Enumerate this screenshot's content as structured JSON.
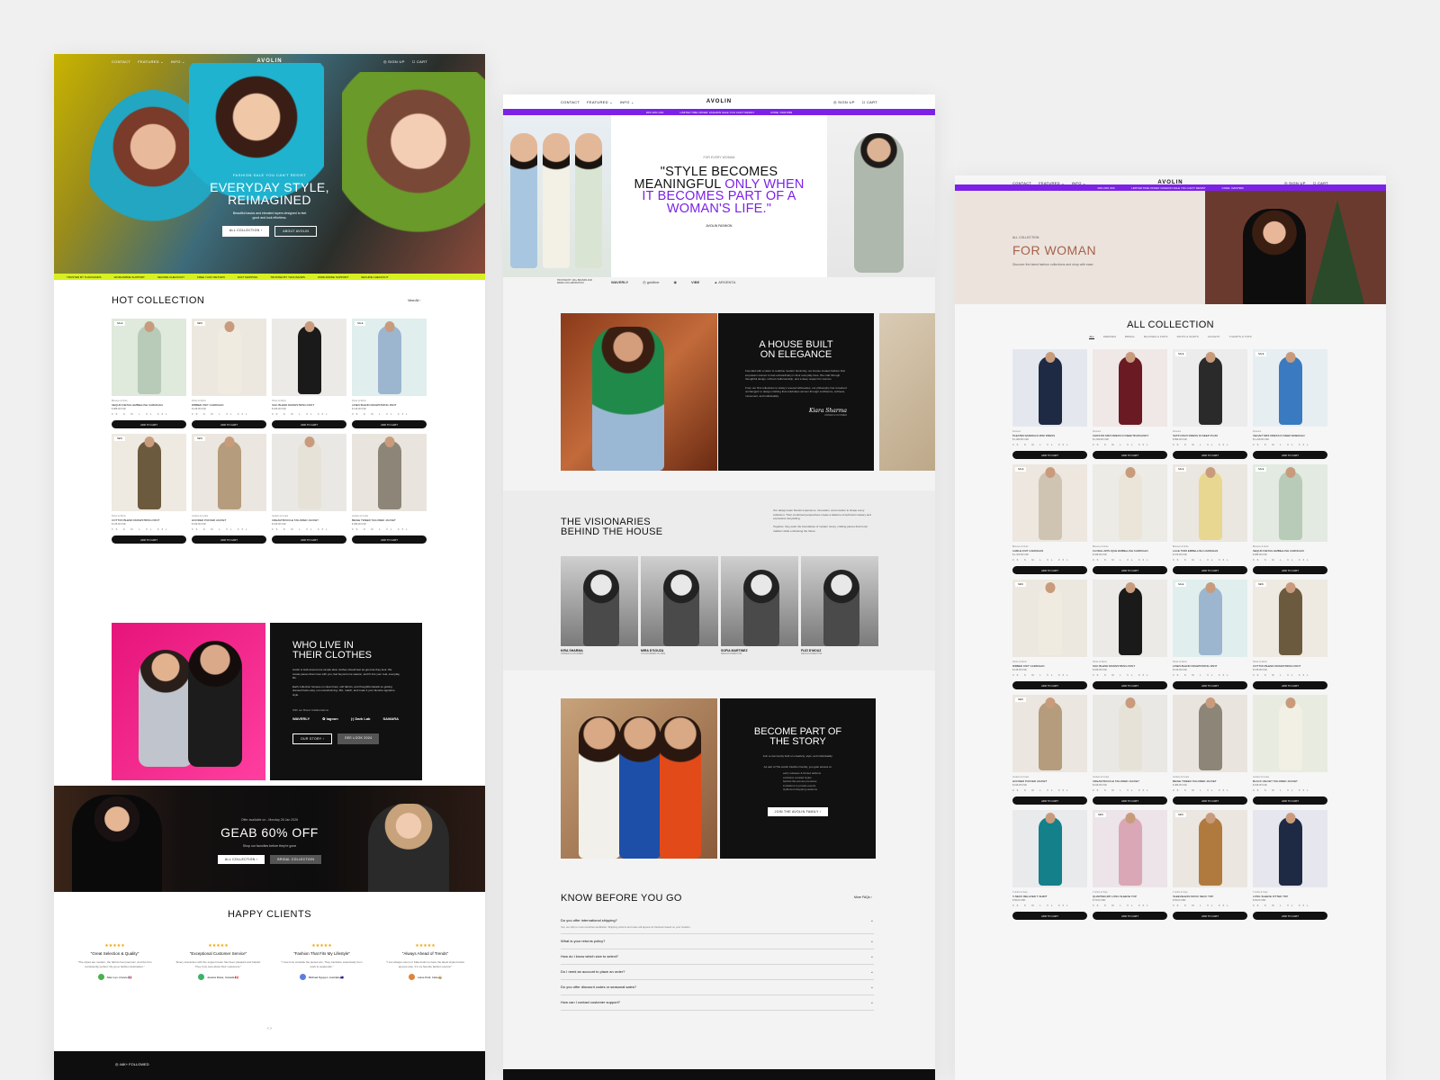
{
  "nav": {
    "left": [
      "CONTACT",
      "FEATURED ⌄",
      "INFO ⌄"
    ],
    "logo": "AVOLIN",
    "right": [
      "◎ SIGN UP",
      "☐ CART"
    ]
  },
  "promo": [
    "20% 20% OFF",
    "LIMITED TIME OFFER: FASHION SALE YOU CAN'T RESIST",
    "CODE: X2047989"
  ],
  "p1": {
    "hero": {
      "kicker": "FASHION SALE YOU CAN'T RESIST",
      "title_1": "EVERYDAY STYLE,",
      "title_2": "REIMAGINED",
      "sub": "Beautiful basics and elevated layers designed to feel good and look effortless.",
      "btn_1": "ALL COLLECTION ›",
      "btn_2": "ABOUT AVOLIN"
    },
    "ticker": [
      "TRUSTED BY THOUSANDS",
      "WORLDWIDE SUPPORT",
      "SECURE CHECKOUT",
      "FREE 7-DAY RETURN",
      "FAST SHIPPING",
      "TRUSTED BY THOUSANDS",
      "WORLDWIDE SUPPORT",
      "SECURE CHECKOUT"
    ],
    "hot_title": "HOT COLLECTION",
    "view_all": "View All ›",
    "products": [
      {
        "badge": "SALE",
        "cat": "Blouses & Knits",
        "name": "SEQUIN DETAIL EMBELLISH CARDIGAN",
        "price": "$ 988.00 USD",
        "bg": "#dfe9dc",
        "col": "#b7cbb8"
      },
      {
        "badge": "NEW",
        "cat": "Pants & Skirts",
        "name": "RIBBED KNIT CARDIGAN",
        "price": "$ 148.00 USD",
        "bg": "#ede8df",
        "col": "#f0ebe0"
      },
      {
        "badge": "",
        "cat": "Pants & Skirts",
        "name": "SILK BLEND DRAWSTRING PANT",
        "price": "$ 189.00 USD",
        "bg": "#eceae6",
        "col": "#1a1a1a"
      },
      {
        "badge": "SALE",
        "cat": "Pants & Skirts",
        "name": "LINEN BLEND DRAWSTRING PANT",
        "price": "$ 149.00 USD",
        "bg": "#e0eeed",
        "col": "#9cb6cf"
      },
      {
        "badge": "NEW",
        "cat": "Pants & Skirts",
        "name": "COTTON BLEND DRAWSTRING PANT",
        "price": "$ 135.00 USD",
        "bg": "#eee9e1",
        "col": "#6b5a3e"
      },
      {
        "badge": "NEW",
        "cat": "Jackets & Coats",
        "name": "HOODED PUFFER JACKET",
        "price": "$ 199.00 USD",
        "bg": "#ebe6df",
        "col": "#b59c7c"
      },
      {
        "badge": "",
        "cat": "Jackets & Coats",
        "name": "CREAM BOUCLE TAILORED JACKET",
        "price": "$ 199.00 USD",
        "bg": "#eae8e4",
        "col": "#e6e2d8"
      },
      {
        "badge": "",
        "cat": "Jackets & Coats",
        "name": "BEIGE TWEED TAILORED JACKET",
        "price": "$ 489.00 USD",
        "bg": "#e9e5de",
        "col": "#8c8578"
      }
    ],
    "sizes": "XS S M L XL XXL",
    "add_label": "ADD TO CART",
    "who": {
      "title_1": "WHO LIVE IN",
      "title_2": "THEIR CLOTHES",
      "p1": "Avolin is built around one simple idea: clothes should feel as good as they look. We create pieces that move with you, last beyond one season, and fit into your real, everyday life.",
      "p2": "Each collection focuses on clean lines, soft fabrics, and thoughtful details so getting dressed feels easy, not overwhelming. Mix, match, and make it your favorite signature style.",
      "with": "With our Brand Collaborations",
      "logos": [
        "WAVERLY",
        "✿ lagoon",
        "|·| Dark Lab",
        "SAMARA"
      ],
      "btn_1": "OUR STORY ›",
      "btn_2": "SEE LOOK 2024"
    },
    "sale": {
      "offer": "Offer available on - Monday 26 Jan 2026",
      "title": "GEAB 60% OFF",
      "sub": "Shop our favorites before they're gone",
      "btn_1": "ALL COLLECTION ›",
      "btn_2": "BRIDAL COLLECTION"
    },
    "happy_title": "HAPPY CLIENTS",
    "reviews": [
      {
        "title": "\"Great Selection & Quality\"",
        "body": "\"The styles are modern, the fabrics feel premium, and the fit is consistently perfect. My go-to fashion destination.\"",
        "author": "Allen Lyn, France 🇫🇷",
        "av": "#4caf50"
      },
      {
        "title": "\"Exceptional Customer Service\"",
        "body": "\"Every interaction with the support team has been pleasant and helpful. They truly care about their customers.\"",
        "author": "Jessica Davis, Canada 🇨🇦",
        "av": "#3ab26a"
      },
      {
        "title": "\"Fashion That Fits My Lifestyle\"",
        "body": "\"I love how versatile the pieces are. They transition seamlessly from work to weekends.\"",
        "author": "Michael Nguyen, Australia 🇦🇺",
        "av": "#5b7de0"
      },
      {
        "title": "\"Always Ahead of Trends\"",
        "body": "\"I can always count on Kala Avolin to have the latest styles before anyone else. It's my favorite fashion source!\"",
        "author": "Liane Petit, India 🇮🇳",
        "av": "#e0843a"
      }
    ],
    "pager": "‹   ›",
    "followed": "◎ 44K+ FOLLOWED"
  },
  "p2": {
    "kicker": "FOR EVERY WOMAN",
    "quote_1": "\"STYLE BECOMES",
    "quote_2a": "MEANINGFUL ",
    "quote_2b": "ONLY WHEN",
    "quote_3": "IT BECOMES PART OF A",
    "quote_4": "WOMAN'S LIFE.\"",
    "by": "AVOLIN FASHION",
    "trusted_sm": "TRUSTED BY 100+ BRANDS AND MEDIA COLLABORATION",
    "trusted_logos": [
      "WAVERLY",
      "◎ goldline",
      "◉",
      "VIBE",
      "▲ ARGENTA"
    ],
    "house": {
      "title_1": "A HOUSE BUILT",
      "title_2": "ON ELEGANCE",
      "p1": "Founded with a vision to redefine modern femininity, our House creates fashion that empowers women to feel extraordinary in their everyday lives. We craft through thoughtful design, refined craftsmanship, and a deep respect for woman.",
      "p2": "From our first collections to today's revered silhouettes, our philosophy has remained unchanged: to design clothing that celebrates women through confidence, softness, movement, and individuality.",
      "sig": "Kiara Sharma",
      "sig_role": "OWNER & FOUNDER"
    },
    "vis": {
      "title_1": "THE VISIONARIES",
      "title_2": "BEHIND THE HOUSE",
      "p1": "Our design team blends experience, innovation, and emotion to shape every collection. Their combined perspectives create a balance of technical mastery and expressive storytelling.",
      "p2": "Together, they push the boundaries of modern luxury, crafting pieces that honor tradition while embracing the future.",
      "team": [
        {
          "name": "KIRA SHARMA",
          "role": "OWNER & FOUNDER"
        },
        {
          "name": "MIRA D'SOUZA",
          "role": "CO-FOUNDER OF ARM"
        },
        {
          "name": "SOFIA MARTINEZ",
          "role": "DESIGN DIRECTOR"
        },
        {
          "name": "FUZI D'MOUZ",
          "role": "DESIGN DIRECTOR"
        }
      ]
    },
    "story": {
      "title_1": "BECOME PART OF",
      "title_2": "THE STORY",
      "s1": "Join a community built on creativity, style, and individuality.",
      "s2": "As part of The Avolin Fashion Family, you gain access to:",
      "list": [
        "early releases & limited editions",
        "exclusive curated styles",
        "behind-the-scenes previews",
        "invitations to private events",
        "stylist-led shopping sessions"
      ],
      "join": "JOIN THE AVOLIN FAMILY ›"
    },
    "faq_title": "KNOW BEFORE YOU GO",
    "faq_more": "More FAQs ›",
    "faq": [
      {
        "q": "Do you offer international shipping?",
        "a": "Yes, we ship to most countries worldwide. Shipping options and rates will appear at checkout based on your location."
      },
      {
        "q": "What is your returns policy?",
        "a": ""
      },
      {
        "q": "How do I know which size to select?",
        "a": ""
      },
      {
        "q": "Do I need an account to place an order?",
        "a": ""
      },
      {
        "q": "Do you offer discount codes or seasonal sales?",
        "a": ""
      },
      {
        "q": "How can I contact customer support?",
        "a": ""
      }
    ]
  },
  "p3": {
    "kicker": "ALL COLLECTION",
    "title": "FOR WOMAN",
    "sub": "Discover the latest fashion collections and shop with ease.",
    "all_title": "ALL COLLECTION",
    "tabs": [
      "ALL",
      "DRESSES",
      "BRIDAL",
      "BLOUSES & KNITS",
      "PANTS & SKIRTS",
      "JACKETS",
      "T-SHIRTS & TOPS"
    ],
    "products": [
      {
        "badge": "",
        "cat": "Dresses",
        "name": "PLEATED EMERALD MIDI DRESS",
        "price": "$ 1,089.00 USD",
        "bg": "#e4e8ee",
        "col": "#1e2a44"
      },
      {
        "badge": "",
        "cat": "Dresses",
        "name": "CHIFFON MIDI DRESS IN DEEP BURGUNDY",
        "price": "$ 1,099.00 USD",
        "bg": "#efe8e6",
        "col": "#6a1a22"
      },
      {
        "badge": "SALE",
        "cat": "Dresses",
        "name": "SATIN MAXI DRESS IN DEEP PLUM",
        "price": "$ 899.00 USD",
        "bg": "#ececec",
        "col": "#2a2a2a"
      },
      {
        "badge": "SALE",
        "cat": "Dresses",
        "name": "VELVET MIDI DRESS IN DEEP EMERALD",
        "price": "$ 1,249.00 USD",
        "bg": "#e7eef2",
        "col": "#3a7ac0"
      },
      {
        "badge": "SALE",
        "cat": "Blouses & Knits",
        "name": "CABLE KNIT CARDIGAN",
        "price": "$ 1,320.00 USD",
        "bg": "#ede7e0",
        "col": "#cfc3b2"
      },
      {
        "badge": "",
        "cat": "Blouses & Knits",
        "name": "FLORAL APPLIQUE EMBELLISH CARDIGAN",
        "price": "$ 348.00 USD",
        "bg": "#ecebe6",
        "col": "#eae5d8"
      },
      {
        "badge": "SALE",
        "cat": "Blouses & Knits",
        "name": "LACE TRIM EMBELLISH CARDIGAN",
        "price": "$ 379.00 USD",
        "bg": "#eae6e0",
        "col": "#e8d790"
      },
      {
        "badge": "SALE",
        "cat": "Blouses & Knits",
        "name": "SEQUIN DETAIL EMBELLISH CARDIGAN",
        "price": "$ 988.00 USD",
        "bg": "#e2eae1",
        "col": "#b7cbb8"
      },
      {
        "badge": "NEW",
        "cat": "Pants & Skirts",
        "name": "RIBBED KNIT CARDIGAN",
        "price": "$ 148.00 USD",
        "bg": "#ede8df",
        "col": "#f0ebe0"
      },
      {
        "badge": "",
        "cat": "Pants & Skirts",
        "name": "SILK BLEND DRAWSTRING PANT",
        "price": "$ 189.00 USD",
        "bg": "#eceae6",
        "col": "#1a1a1a"
      },
      {
        "badge": "SALE",
        "cat": "Pants & Skirts",
        "name": "LINEN BLEND DRAWSTRING PANT",
        "price": "$ 149.00 USD",
        "bg": "#e0eeed",
        "col": "#9cb6cf"
      },
      {
        "badge": "NEW",
        "cat": "Pants & Skirts",
        "name": "COTTON BLEND DRAWSTRING PANT",
        "price": "$ 135.00 USD",
        "bg": "#eee9e1",
        "col": "#6b5a3e"
      },
      {
        "badge": "NEW",
        "cat": "Jackets & Coats",
        "name": "HOODED PUFFER JACKET",
        "price": "$ 199.00 USD",
        "bg": "#ebe6df",
        "col": "#b59c7c"
      },
      {
        "badge": "",
        "cat": "Jackets & Coats",
        "name": "CREAM BOUCLE TAILORED JACKET",
        "price": "$ 199.00 USD",
        "bg": "#eae8e4",
        "col": "#e6e2d8"
      },
      {
        "badge": "",
        "cat": "Jackets & Coats",
        "name": "BEIGE TWEED TAILORED JACKET",
        "price": "$ 489.00 USD",
        "bg": "#e9e5de",
        "col": "#8c8578"
      },
      {
        "badge": "",
        "cat": "Jackets & Coats",
        "name": "BLACK VELVET TAILORED JACKET",
        "price": "$ 199.00 USD",
        "bg": "#e8ece0",
        "col": "#f2efe4"
      },
      {
        "badge": "",
        "cat": "T-shirts & Tops",
        "name": "V-NECK RELAXED T-SHIRT",
        "price": "$ 59.00 USD",
        "bg": "#e9eaec",
        "col": "#13808a"
      },
      {
        "badge": "NEW",
        "cat": "T-shirts & Tops",
        "name": "QUARTER-ZIP LONG SLEEVE TOP",
        "price": "$ 79.00 USD",
        "bg": "#ece4e8",
        "col": "#d9a7b5"
      },
      {
        "badge": "NEW",
        "cat": "T-shirts & Tops",
        "name": "SLEEVELESS MOCK NECK TOP",
        "price": "$ 69.00 USD",
        "bg": "#ebe6e0",
        "col": "#b07a3e"
      },
      {
        "badge": "",
        "cat": "T-shirts & Tops",
        "name": "LONG SLEEVE FITTED TOP",
        "price": "$ 69.00 USD",
        "bg": "#e6e6ee",
        "col": "#1e2a44"
      }
    ]
  }
}
